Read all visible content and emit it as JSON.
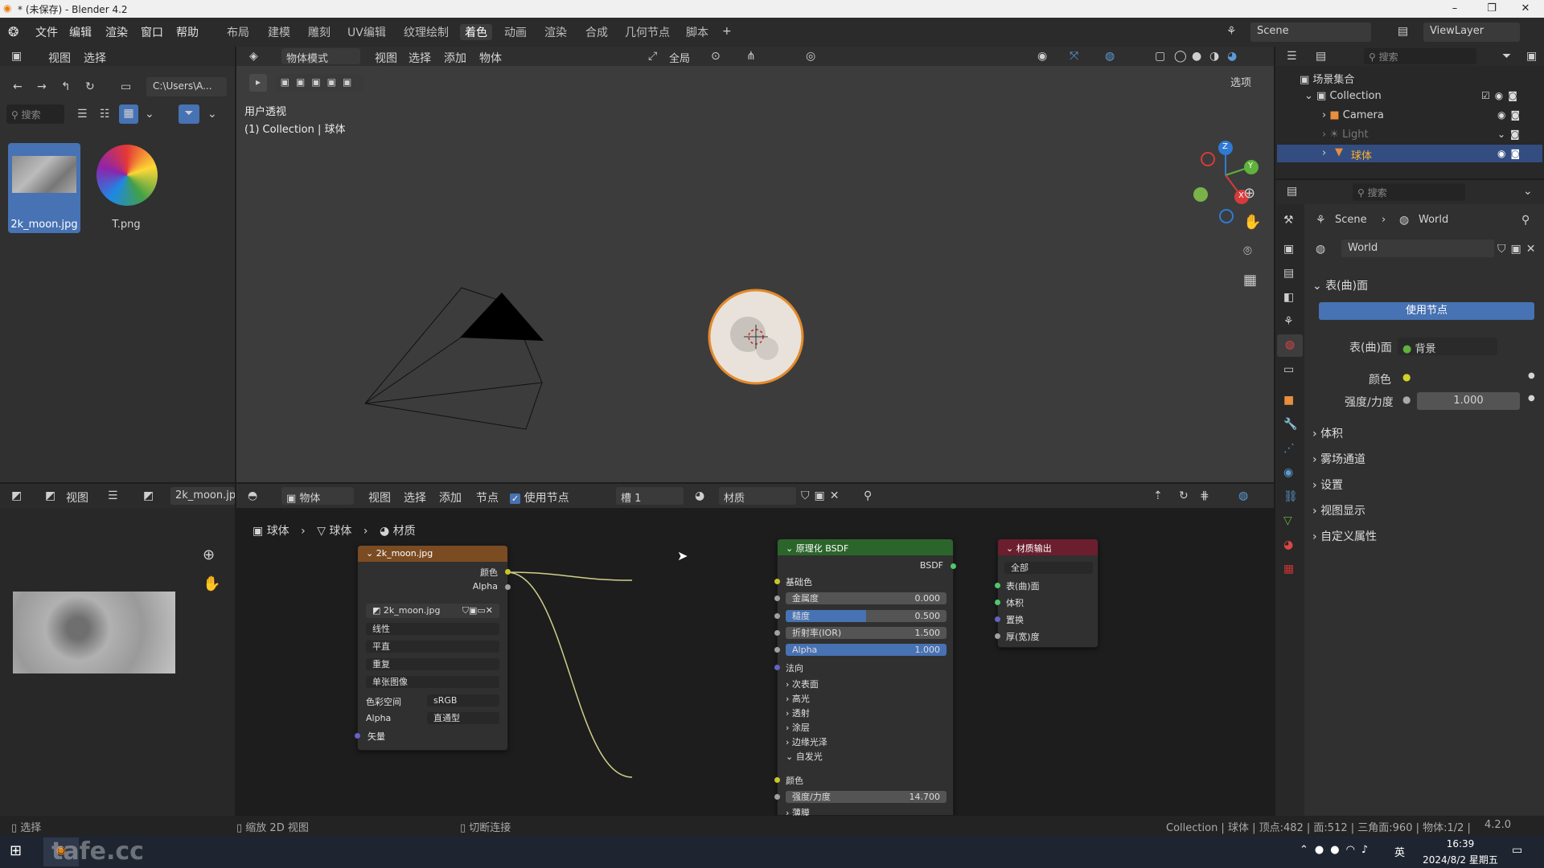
{
  "window": {
    "title": "* (未保存) - Blender 4.2",
    "min": "–",
    "max": "❐",
    "close": "✕"
  },
  "menu": {
    "items": [
      "文件",
      "编辑",
      "渲染",
      "窗口",
      "帮助"
    ]
  },
  "workspaces": [
    "布局",
    "建模",
    "雕刻",
    "UV编辑",
    "纹理绘制",
    "着色",
    "动画",
    "渲染",
    "合成",
    "几何节点",
    "脚本"
  ],
  "workspace_active": "着色",
  "top_right": {
    "scene": "Scene",
    "view_layer": "ViewLayer"
  },
  "file_browser": {
    "view": "视图",
    "select": "选择",
    "path": "C:\\Users\\A...",
    "search_placeholder": "搜索",
    "files": [
      {
        "name": "2k_moon.jpg"
      },
      {
        "name": "T.png"
      }
    ]
  },
  "viewport": {
    "mode": "物体模式",
    "menus": [
      "视图",
      "选择",
      "添加",
      "物体"
    ],
    "transform": "全局",
    "view_name": "用户透视",
    "collection_info": "(1) Collection | 球体",
    "options": "选项"
  },
  "gizmo": {
    "z": "Z",
    "y": "Y",
    "x": "X"
  },
  "outliner": {
    "search_placeholder": "搜索",
    "root": "场景集合",
    "collection": "Collection",
    "items": [
      "Camera",
      "Light",
      "球体"
    ]
  },
  "properties": {
    "search_placeholder": "搜索",
    "breadcrumb": [
      "Scene",
      "World"
    ],
    "world_name": "World",
    "sections": {
      "surface": "表(曲)面",
      "use_nodes": "使用节点",
      "surface_label": "表(曲)面",
      "surface_value": "背景",
      "color_label": "颜色",
      "strength_label": "强度/力度",
      "strength_value": "1.000",
      "volume": "体积",
      "mist": "雾场通道",
      "settings": "设置",
      "viewport_display": "视图显示",
      "custom_props": "自定义属性"
    }
  },
  "image_editor": {
    "view": "视图",
    "image_name": "2k_moon.jp"
  },
  "node_editor": {
    "header": {
      "object": "物体",
      "menus": [
        "视图",
        "选择",
        "添加",
        "节点"
      ],
      "use_nodes": "使用节点",
      "slot": "槽 1",
      "material": "材质"
    },
    "breadcrumb": [
      "球体",
      "球体",
      "材质"
    ]
  },
  "image_node": {
    "title": "2k_moon.jpg",
    "out_color": "颜色",
    "out_alpha": "Alpha",
    "image": "2k_moon.jpg",
    "interp": "线性",
    "proj": "平直",
    "ext": "重复",
    "source": "单张图像",
    "colorspace_label": "色彩空间",
    "colorspace": "sRGB",
    "alpha_label": "Alpha",
    "alpha": "直通型",
    "vector": "矢量"
  },
  "bsdf_node": {
    "title": "原理化 BSDF",
    "out": "BSDF",
    "base_color": "基础色",
    "metallic": "金属度",
    "metallic_val": "0.000",
    "roughness": "糙度",
    "roughness_val": "0.500",
    "ior": "折射率(IOR)",
    "ior_val": "1.500",
    "alpha": "Alpha",
    "alpha_val": "1.000",
    "normal": "法向",
    "subsurface": "次表面",
    "specular": "高光",
    "transmission": "透射",
    "coat": "涂层",
    "sheen": "边缘光泽",
    "emission": "自发光",
    "emission_color": "颜色",
    "emission_strength": "强度/力度",
    "emission_strength_val": "14.700",
    "thin_film": "薄膜"
  },
  "output_node": {
    "title": "材质输出",
    "target": "全部",
    "surface": "表(曲)面",
    "volume": "体积",
    "displacement": "置换",
    "thickness": "厚(宽)度"
  },
  "status": {
    "select": "选择",
    "zoom": "缩放 2D 视图",
    "cut": "切断连接",
    "info": "Collection | 球体 | 顶点:482 | 面:512 | 三角面:960 | 物体:1/2 |",
    "version": "4.2.0"
  },
  "taskbar": {
    "time": "16:39",
    "date": "2024/8/2 星期五",
    "lang": "英",
    "watermark": "tafe.cc"
  }
}
